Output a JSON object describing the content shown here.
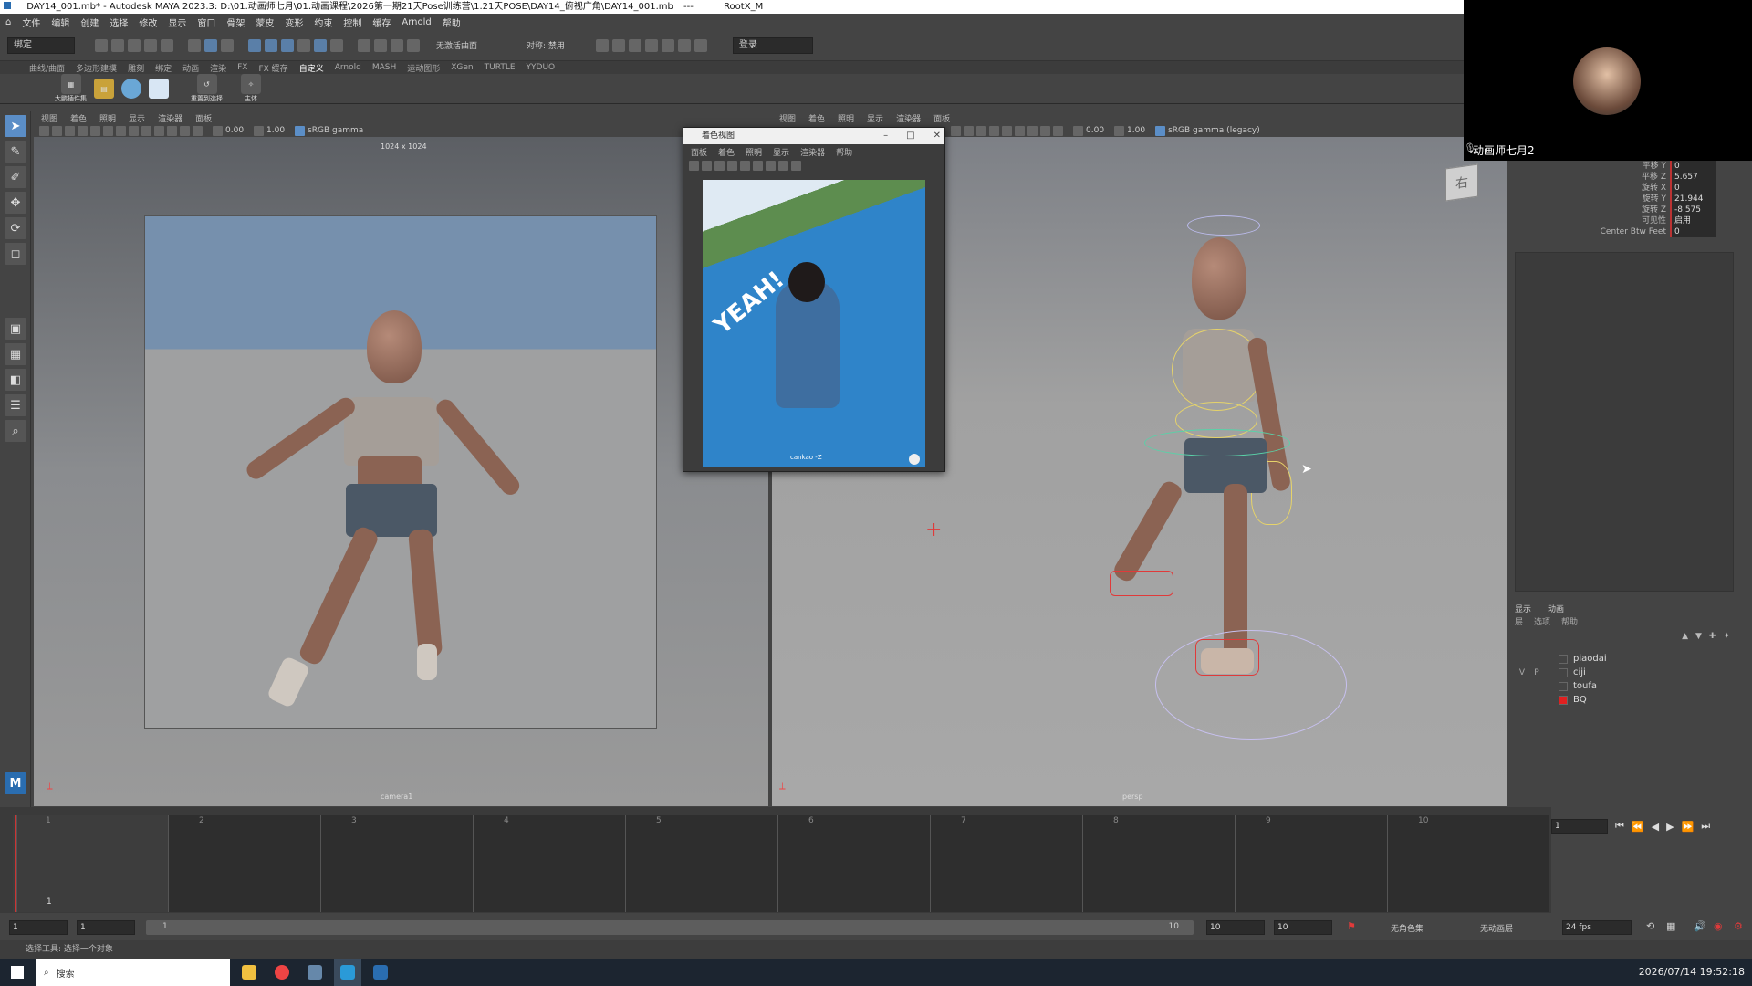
{
  "title_bar": {
    "text": "DAY14_001.mb* - Autodesk MAYA 2023.3: D:\\01.动画师七月\\01.动画课程\\2026第一期21天Pose训练营\\1.21天POSE\\DAY14_俯视广角\\DAY14_001.mb",
    "separator": "---",
    "root": "RootX_M"
  },
  "menu_bar": [
    "文件",
    "编辑",
    "创建",
    "选择",
    "修改",
    "显示",
    "窗口",
    "骨架",
    "蒙皮",
    "变形",
    "约束",
    "控制",
    "缓存",
    "Arnold",
    "帮助"
  ],
  "status_line": {
    "mode_dropdown": "绑定",
    "live_surface": "无激活曲面",
    "symmetry": "对称: 禁用",
    "login": "登录"
  },
  "shelf_tabs": [
    "曲线/曲面",
    "多边形建模",
    "雕刻",
    "绑定",
    "动画",
    "渲染",
    "FX",
    "FX 缓存",
    "自定义",
    "Arnold",
    "MASH",
    "运动图形",
    "XGen",
    "TURTLE",
    "YYDUO"
  ],
  "shelf_active_tab": "自定义",
  "shelf_labels": [
    "大鹏插件集",
    "重置到选择",
    "主体"
  ],
  "left_panel": {
    "menu": [
      "视图",
      "着色",
      "照明",
      "显示",
      "渲染器",
      "面板"
    ],
    "exposure": "0.00",
    "gamma": "1.00",
    "color_space": "sRGB gamma",
    "resolution_label": "1024 x 1024",
    "camera_label": "camera1"
  },
  "right_panel": {
    "menu": [
      "视图",
      "着色",
      "照明",
      "显示",
      "渲染器",
      "面板"
    ],
    "exposure": "0.00",
    "gamma": "1.00",
    "color_space": "sRGB gamma (legacy)",
    "camera_label": "persp",
    "viewcube": "右"
  },
  "ref_window": {
    "title": "着色视图",
    "menu": [
      "面板",
      "着色",
      "照明",
      "显示",
      "渲染器",
      "帮助"
    ],
    "image_text": "YEAH!",
    "caption": "cankao -Z"
  },
  "webcam": {
    "name": "动画师七月2"
  },
  "channel_box": {
    "attrs": [
      {
        "label": "平移 Y",
        "value": "0"
      },
      {
        "label": "平移 Z",
        "value": "5.657"
      },
      {
        "label": "旋转 X",
        "value": "0"
      },
      {
        "label": "旋转 Y",
        "value": "21.944"
      },
      {
        "label": "旋转 Z",
        "value": "-8.575"
      },
      {
        "label": "可见性",
        "value": "启用"
      },
      {
        "label": "Center Btw Feet",
        "value": "0"
      }
    ]
  },
  "layer_editor": {
    "tabs": [
      "显示",
      "动画"
    ],
    "menu": [
      "层",
      "选项",
      "帮助"
    ],
    "layers": [
      {
        "vis": "",
        "ref": "",
        "name": "piaodai",
        "color": "#444444"
      },
      {
        "vis": "V",
        "ref": "P",
        "name": "ciji",
        "color": "#444444"
      },
      {
        "vis": "",
        "ref": "",
        "name": "toufa",
        "color": "#444444"
      },
      {
        "vis": "",
        "ref": "",
        "name": "BQ",
        "color": "#e02020"
      }
    ]
  },
  "timeline": {
    "ticks": [
      "1",
      "2",
      "3",
      "4",
      "5",
      "6",
      "7",
      "8",
      "9",
      "10"
    ],
    "current_frame_marker": "1",
    "current_frame_field": "1"
  },
  "range_bar": {
    "start": "1",
    "anim_start": "1",
    "range_slider_start": "1",
    "range_slider_end": "10",
    "end": "10",
    "anim_end": "10",
    "char_set": "无角色集",
    "anim_layer": "无动画层",
    "fps": "24 fps"
  },
  "command_line": {
    "text": "选择工具: 选择一个对象"
  },
  "taskbar": {
    "search_placeholder": "搜索",
    "clock": "2026/07/14 19:52:18"
  },
  "colors": {
    "selection_blue": "#5b8ec7",
    "control_yellow": "#e6d36a",
    "control_red": "#e03a3a",
    "layer_bq": "#e02020"
  }
}
